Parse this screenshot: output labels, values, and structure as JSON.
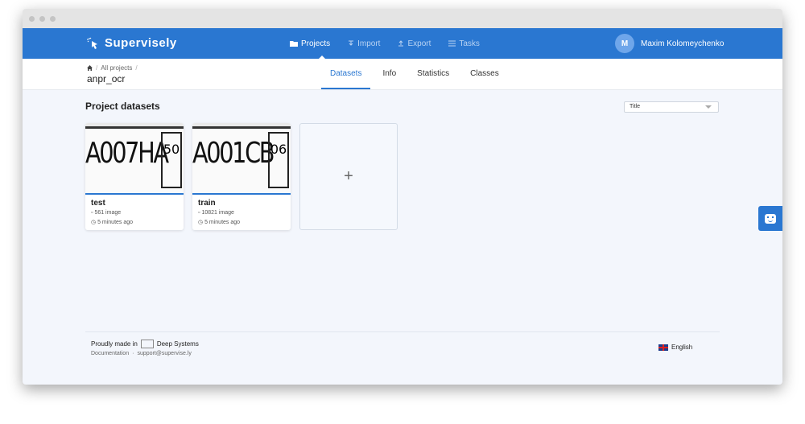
{
  "app": {
    "logo_text": "Supervisely"
  },
  "nav": {
    "items": [
      {
        "label": "Projects",
        "icon": "folder-icon",
        "active": true
      },
      {
        "label": "Import",
        "icon": "import-icon",
        "active": false
      },
      {
        "label": "Export",
        "icon": "export-icon",
        "active": false
      },
      {
        "label": "Tasks",
        "icon": "list-icon",
        "active": false
      }
    ]
  },
  "user": {
    "initial": "M",
    "name": "Maxim Kolomeychenko"
  },
  "breadcrumb": {
    "home_icon": "home-icon",
    "items": [
      "All projects"
    ],
    "separator": "/"
  },
  "project": {
    "name": "anpr_ocr"
  },
  "tabs": [
    {
      "label": "Datasets",
      "active": true
    },
    {
      "label": "Info",
      "active": false
    },
    {
      "label": "Statistics",
      "active": false
    },
    {
      "label": "Classes",
      "active": false
    }
  ],
  "main": {
    "section_title": "Project datasets",
    "sort_value": "Title",
    "add_symbol": "+"
  },
  "datasets": [
    {
      "name": "test",
      "count": "561 image",
      "time": "5 minutes ago",
      "plate_text": "A007HA",
      "plate_region": "50"
    },
    {
      "name": "train",
      "count": "10821 image",
      "time": "5 minutes ago",
      "plate_text": "A001CB",
      "plate_region": "06"
    }
  ],
  "footer": {
    "made_in": "Proudly made in",
    "company": "Deep Systems",
    "doc_link": "Documentation",
    "dot": "·",
    "support_link": "support@supervise.ly",
    "language": "English"
  },
  "colors": {
    "accent": "#2a77d1",
    "background": "#f3f6fc"
  }
}
